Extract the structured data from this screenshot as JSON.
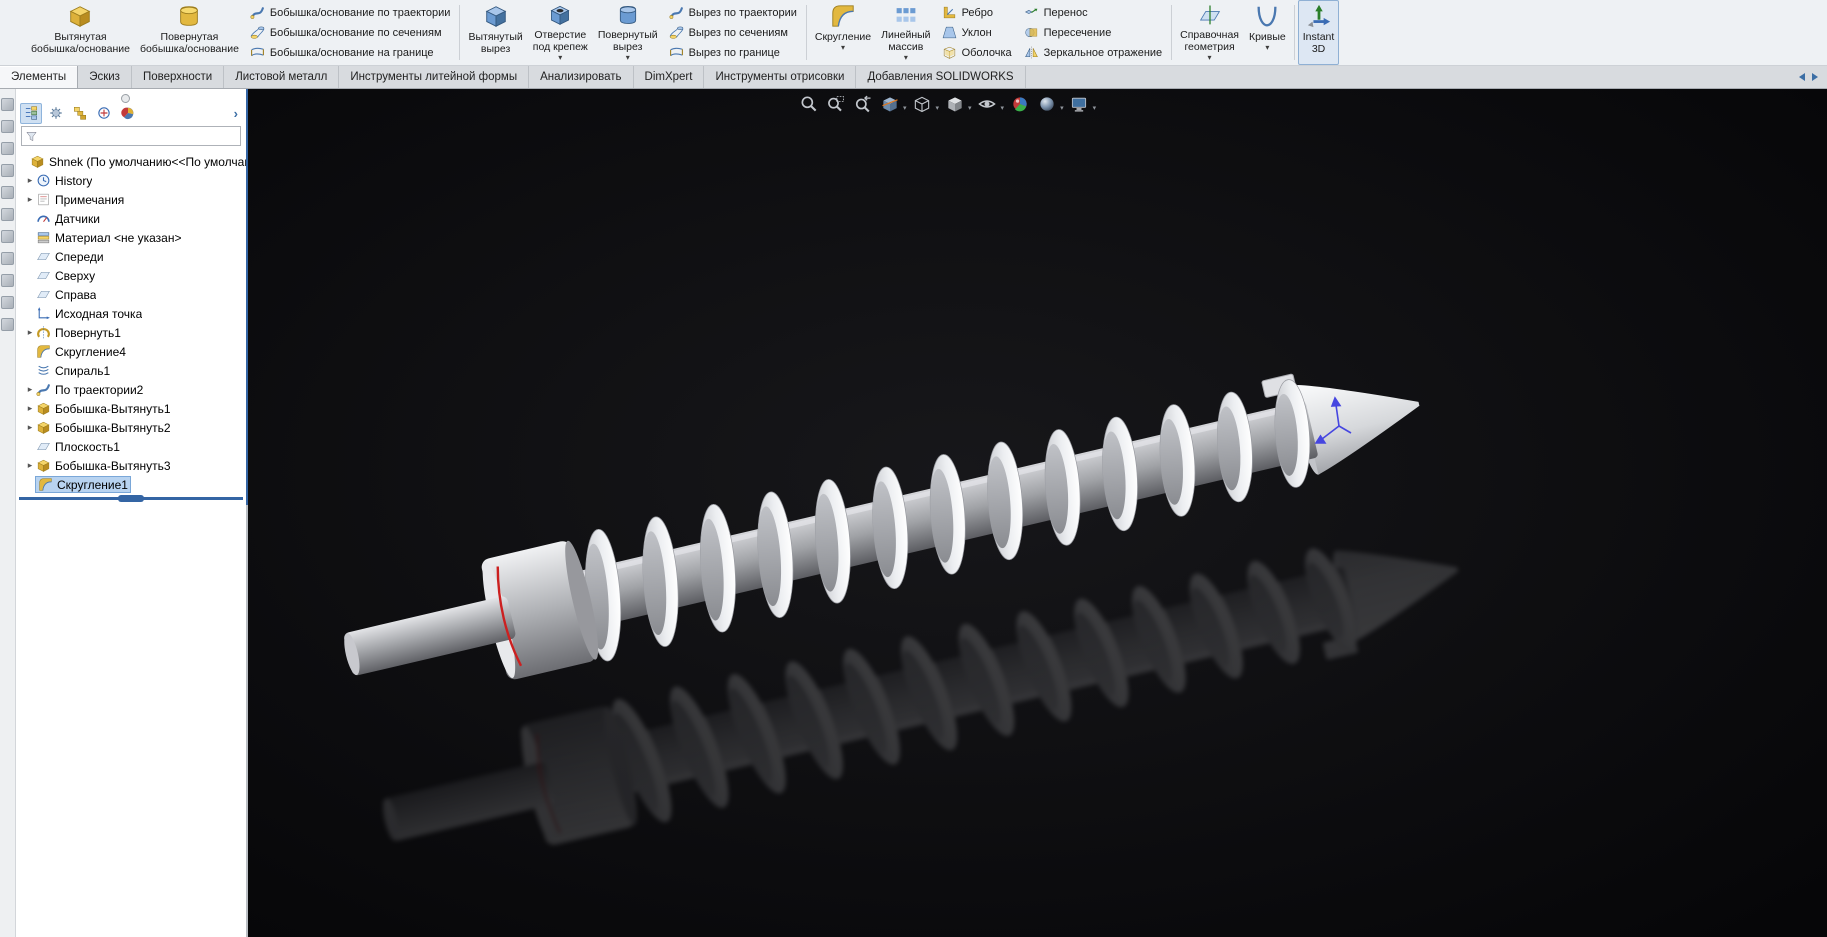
{
  "app": {
    "name": "SOLIDWORKS",
    "document": "Shnek"
  },
  "colors": {
    "accent_blue": "#3465a4",
    "selection_fill": "#b8d3f0",
    "viewport_background": "#0a0a0c",
    "ribbon_background": "#eef1f4",
    "active_button_background": "#dde7f3"
  },
  "ribbon": {
    "big": [
      {
        "label": "Вытянутая\nбобышка/основание",
        "icon": "extruded-boss-icon"
      },
      {
        "label": "Повернутая\nбобышка/основание",
        "icon": "revolved-boss-icon"
      },
      {
        "label": "Вытянутый\nвырез",
        "icon": "extruded-cut-icon"
      },
      {
        "label": "Отверстие\nпод крепеж",
        "icon": "hole-wizard-icon"
      },
      {
        "label": "Повернутый\nвырез",
        "icon": "revolved-cut-icon"
      },
      {
        "label": "Скругление",
        "icon": "fillet-icon"
      },
      {
        "label": "Линейный\nмассив",
        "icon": "linear-pattern-icon"
      },
      {
        "label": "Справочная\nгеометрия",
        "icon": "reference-geometry-icon"
      },
      {
        "label": "Кривые",
        "icon": "curves-icon"
      },
      {
        "label": "Instant\n3D",
        "icon": "instant-3d-icon",
        "active": true
      }
    ],
    "stack_boss": [
      "Бобышка/основание по траектории",
      "Бобышка/основание по сечениям",
      "Бобышка/основание на границе"
    ],
    "stack_cut": [
      "Вырез по траектории",
      "Вырез по сечениям",
      "Вырез по границе"
    ],
    "stack_shape": [
      "Ребро",
      "Уклон",
      "Оболочка"
    ],
    "stack_transform": [
      "Перенос",
      "Пересечение",
      "Зеркальное отражение"
    ]
  },
  "tabs": {
    "items": [
      "Элементы",
      "Эскиз",
      "Поверхности",
      "Листовой металл",
      "Инструменты литейной формы",
      "Анализировать",
      "DimXpert",
      "Инструменты отрисовки",
      "Добавления SOLIDWORKS"
    ],
    "active": "Элементы"
  },
  "feature_tree": {
    "filter_value": "",
    "root_label": "Shnek  (По умолчанию<<По умолчанию:",
    "items": [
      {
        "label": "History",
        "icon": "history-icon",
        "expandable": true
      },
      {
        "label": "Примечания",
        "icon": "annotations-icon",
        "expandable": true
      },
      {
        "label": "Датчики",
        "icon": "sensors-icon",
        "expandable": false
      },
      {
        "label": "Материал <не указан>",
        "icon": "material-icon",
        "expandable": false
      },
      {
        "label": "Спереди",
        "icon": "plane-icon",
        "expandable": false
      },
      {
        "label": "Сверху",
        "icon": "plane-icon",
        "expandable": false
      },
      {
        "label": "Справа",
        "icon": "plane-icon",
        "expandable": false
      },
      {
        "label": "Исходная точка",
        "icon": "origin-icon",
        "expandable": false
      },
      {
        "label": "Повернуть1",
        "icon": "revolve-feature-icon",
        "expandable": true
      },
      {
        "label": "Скругление4",
        "icon": "fillet-feature-icon",
        "expandable": false
      },
      {
        "label": "Спираль1",
        "icon": "helix-feature-icon",
        "expandable": false
      },
      {
        "label": "По траектории2",
        "icon": "sweep-feature-icon",
        "expandable": true
      },
      {
        "label": "Бобышка-Вытянуть1",
        "icon": "extrude-feature-icon",
        "expandable": true
      },
      {
        "label": "Бобышка-Вытянуть2",
        "icon": "extrude-feature-icon",
        "expandable": true
      },
      {
        "label": "Плоскость1",
        "icon": "plane-feature-icon",
        "expandable": false
      },
      {
        "label": "Бобышка-Вытянуть3",
        "icon": "extrude-feature-icon",
        "expandable": true
      },
      {
        "label": "Скругление1",
        "icon": "fillet-feature-icon",
        "expandable": false,
        "selected": true
      }
    ]
  },
  "viewport": {
    "model": "screw-auger (Shnek) shaded with reflection",
    "heads_up_toolbar": [
      "zoom-fit",
      "zoom-area",
      "previous-view",
      "section-view",
      "view-orientation",
      "display-style",
      "hide-show-items",
      "edit-appearance",
      "apply-scene",
      "view-settings"
    ]
  },
  "icons": {
    "funnel": "filter funnel shape",
    "expand-arrow": "▸",
    "dropdown-caret": "▾",
    "zoom-fit": "magnifier",
    "view-orientation": "wireframe cube",
    "hide-show-items": "eye",
    "edit-appearance": "colored sphere",
    "view-settings": "monitor"
  }
}
